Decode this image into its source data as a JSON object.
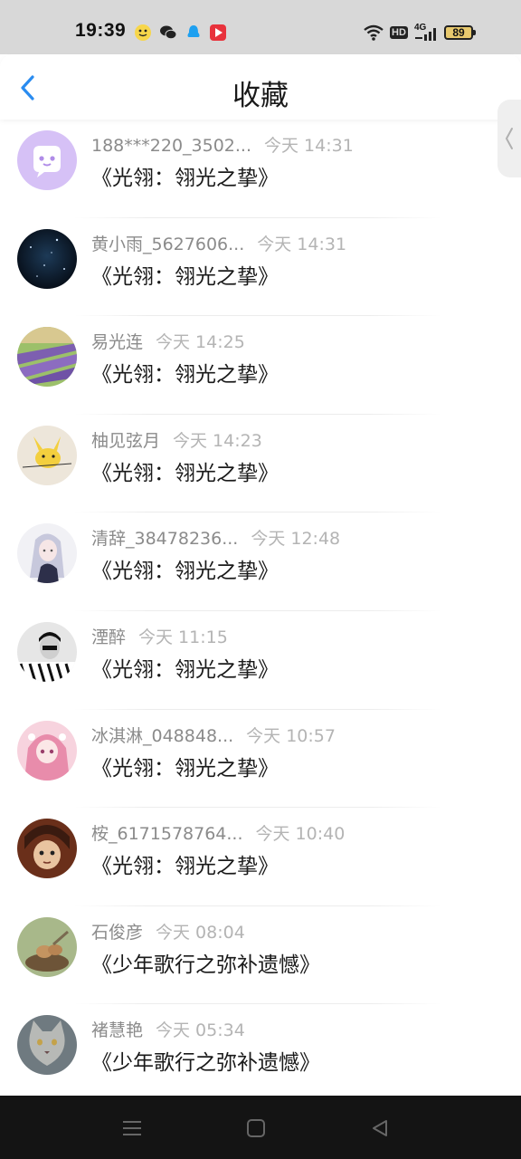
{
  "status_bar": {
    "time": "19:39",
    "hd_label": "HD",
    "network_label": "4G",
    "battery": "89"
  },
  "header": {
    "title": "收藏"
  },
  "items": [
    {
      "name": "188***220_3502...",
      "time": "今天 14:31",
      "title": "《光翎：翎光之挚》",
      "avatar": "ghost-avatar"
    },
    {
      "name": "黄小雨_5627606...",
      "time": "今天 14:31",
      "title": "《光翎：翎光之挚》",
      "avatar": "starry-avatar"
    },
    {
      "name": "易光连",
      "time": "今天 14:25",
      "title": "《光翎：翎光之挚》",
      "avatar": "lavender-field-avatar"
    },
    {
      "name": "柚见弦月",
      "time": "今天 14:23",
      "title": "《光翎：翎光之挚》",
      "avatar": "pikachu-avatar"
    },
    {
      "name": "清辞_38478236...",
      "time": "今天 12:48",
      "title": "《光翎：翎光之挚》",
      "avatar": "anime-girl-avatar"
    },
    {
      "name": "湮醉",
      "time": "今天 11:15",
      "title": "《光翎：翎光之挚》",
      "avatar": "bw-portrait-avatar"
    },
    {
      "name": "冰淇淋_048848...",
      "time": "今天 10:57",
      "title": "《光翎：翎光之挚》",
      "avatar": "pink-doll-avatar"
    },
    {
      "name": "桉_6171578764...",
      "time": "今天 10:40",
      "title": "《光翎：翎光之挚》",
      "avatar": "cartoon-boy-avatar"
    },
    {
      "name": "石俊彦",
      "time": "今天 08:04",
      "title": "《少年歌行之弥补遗憾》",
      "avatar": "bird-nest-avatar"
    },
    {
      "name": "褚慧艳",
      "time": "今天 05:34",
      "title": "《少年歌行之弥补遗憾》",
      "avatar": "cat-avatar"
    }
  ],
  "colors": {
    "accent": "#2a8cf0",
    "name_text": "#8b8b8b",
    "time_text": "#b4b4b4"
  }
}
